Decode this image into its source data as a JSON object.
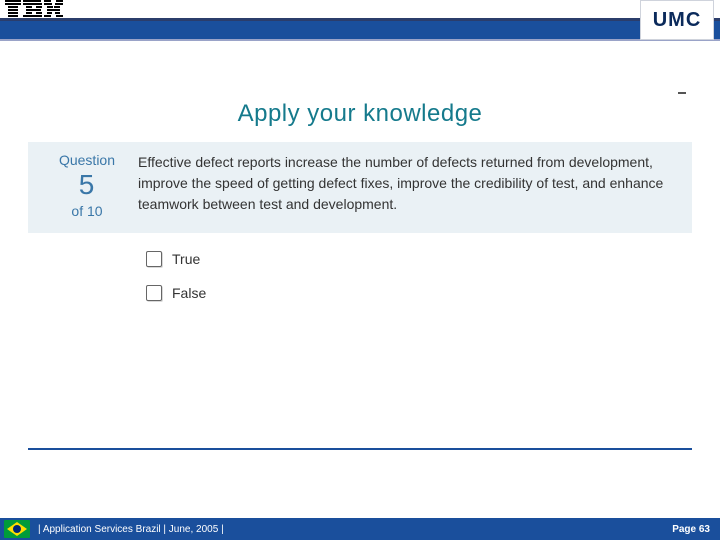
{
  "header": {
    "umc_label": "UMC"
  },
  "title": "Apply your knowledge",
  "question": {
    "label": "Question",
    "number": "5",
    "of_text": "of 10",
    "text": "Effective defect reports increase the number of defects returned from development, improve the speed of getting defect fixes, improve the credibility of test, and enhance teamwork between test and development."
  },
  "choices": {
    "true_label": "True",
    "false_label": "False"
  },
  "footer": {
    "left": "|  Application Services Brazil  |  June, 2005  |",
    "right": "Page 63"
  }
}
